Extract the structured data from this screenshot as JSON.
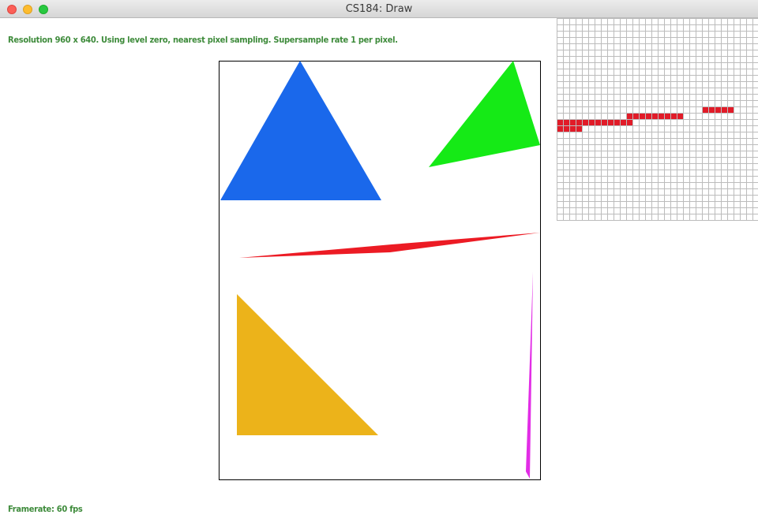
{
  "window": {
    "title": "CS184: Draw"
  },
  "status": {
    "info": "Resolution 960 x 640. Using level zero, nearest pixel sampling. Supersample rate 1 per pixel.",
    "framerate": "Framerate: 60 fps"
  },
  "colors": {
    "status_text": "#3e8b3b",
    "blue_triangle": "#1a68eb",
    "green_triangle": "#15ea16",
    "red_triangle": "#ec1b24",
    "yellow_triangle": "#ecb31a",
    "magenta_triangle": "#e22de6",
    "zoom_grid_line": "#bcbcbc",
    "zoom_pixel": "#e11b28"
  },
  "zoom_view": {
    "grid_columns": 32,
    "grid_rows": 32
  }
}
